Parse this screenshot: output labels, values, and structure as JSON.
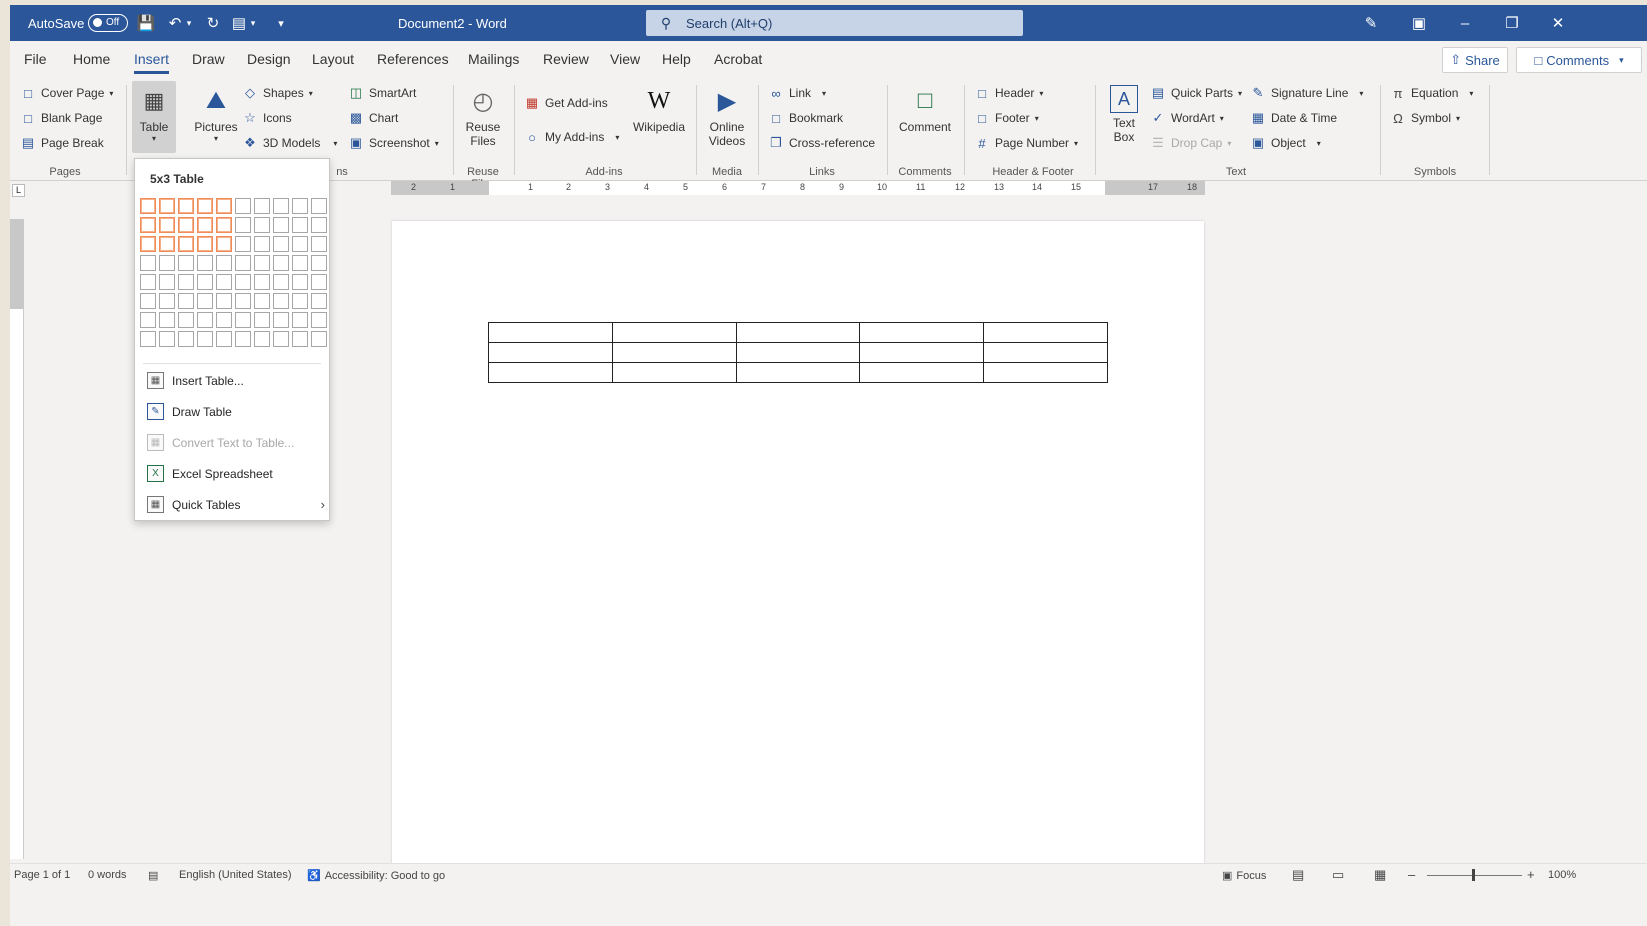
{
  "titlebar": {
    "autosave_label": "AutoSave",
    "autosave_state": "Off",
    "document_title": "Document2 - Word",
    "search_placeholder": "Search (Alt+Q)",
    "bg_color": "#2b579a"
  },
  "menu": {
    "tabs": [
      "File",
      "Home",
      "Insert",
      "Draw",
      "Design",
      "Layout",
      "References",
      "Mailings",
      "Review",
      "View",
      "Help",
      "Acrobat"
    ],
    "active_tab": "Insert",
    "share_label": "Share",
    "comments_label": "Comments"
  },
  "ribbon": {
    "pages": {
      "cover_page": "Cover Page",
      "blank_page": "Blank Page",
      "page_break": "Page Break",
      "group": "Pages"
    },
    "tables": {
      "table": "Table"
    },
    "illustrations": {
      "pictures": "Pictures",
      "shapes": "Shapes",
      "icons": "Icons",
      "models_3d": "3D Models",
      "smartart": "SmartArt",
      "chart": "Chart",
      "screenshot": "Screenshot",
      "group_partial": "ns"
    },
    "reuse": {
      "reuse_files_1": "Reuse",
      "reuse_files_2": "Files",
      "group": "Reuse Files"
    },
    "addins": {
      "get_addins": "Get Add-ins",
      "my_addins": "My Add-ins",
      "wikipedia": "Wikipedia",
      "group": "Add-ins"
    },
    "media": {
      "online_videos_1": "Online",
      "online_videos_2": "Videos",
      "group": "Media"
    },
    "links": {
      "link": "Link",
      "bookmark": "Bookmark",
      "cross_reference": "Cross-reference",
      "group": "Links"
    },
    "comments": {
      "comment": "Comment",
      "group": "Comments"
    },
    "header_footer": {
      "header": "Header",
      "footer": "Footer",
      "page_number": "Page Number",
      "group": "Header & Footer"
    },
    "text": {
      "text_box_1": "Text",
      "text_box_2": "Box",
      "quick_parts": "Quick Parts",
      "wordart": "WordArt",
      "drop_cap": "Drop Cap",
      "signature_line": "Signature Line",
      "date_time": "Date & Time",
      "object": "Object",
      "group": "Text"
    },
    "symbols": {
      "equation": "Equation",
      "symbol": "Symbol",
      "group": "Symbols"
    }
  },
  "table_dropdown": {
    "title": "5x3 Table",
    "grid_cols": 10,
    "grid_rows": 8,
    "selected_cols": 5,
    "selected_rows": 3,
    "highlight_color": "#f08c5a",
    "items": {
      "insert_table": "Insert Table...",
      "draw_table": "Draw Table",
      "convert_text": "Convert Text to Table...",
      "excel_spreadsheet": "Excel Spreadsheet",
      "quick_tables": "Quick Tables"
    }
  },
  "document": {
    "table_cols": 5,
    "table_rows": 3
  },
  "ruler": {
    "ticks": [
      "2",
      "1",
      "1",
      "2",
      "3",
      "4",
      "5",
      "6",
      "7",
      "8",
      "9",
      "10",
      "11",
      "12",
      "13",
      "14",
      "15",
      "17",
      "18"
    ]
  },
  "statusbar": {
    "page": "Page 1 of 1",
    "words": "0 words",
    "language": "English (United States)",
    "accessibility": "Accessibility: Good to go",
    "focus": "Focus",
    "zoom": "100%"
  }
}
